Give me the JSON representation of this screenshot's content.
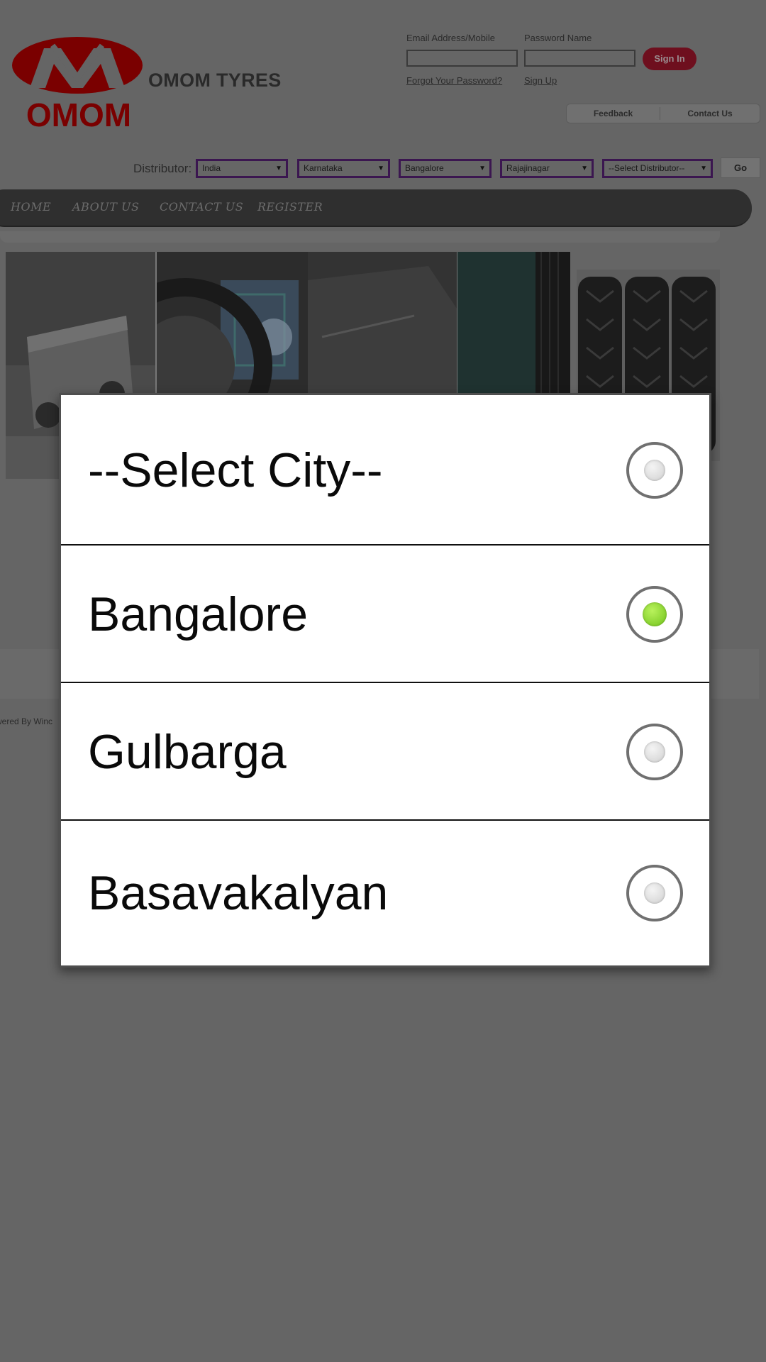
{
  "site": {
    "title": "OMOM TYRES",
    "logo_text": "OMOM"
  },
  "login": {
    "email_label": "Email Address/Mobile",
    "password_label": "Password Name",
    "email_value": "",
    "password_value": "",
    "signin_label": "Sign In",
    "forgot_link": "Forgot Your Password?",
    "signup_link": "Sign Up"
  },
  "utility": {
    "feedback": "Feedback",
    "contact": "Contact Us"
  },
  "distributor": {
    "label": "Distributor:",
    "selects": [
      "India",
      "Karnataka",
      "Bangalore",
      "Rajajinagar",
      "--Select Distributor--"
    ],
    "go_label": "Go"
  },
  "nav": {
    "items": [
      "HOME",
      "ABOUT US",
      "CONTACT US",
      "REGISTER"
    ]
  },
  "footer": {
    "text": "wered By Winc"
  },
  "city_dialog": {
    "options": [
      {
        "label": "--Select City--",
        "selected": false
      },
      {
        "label": "Bangalore",
        "selected": true
      },
      {
        "label": "Gulbarga",
        "selected": false
      },
      {
        "label": "Basavakalyan",
        "selected": false
      }
    ]
  },
  "colors": {
    "logo_red": "#7a0000",
    "radio_selected": "#7ed321",
    "dim_background": "#656565"
  }
}
